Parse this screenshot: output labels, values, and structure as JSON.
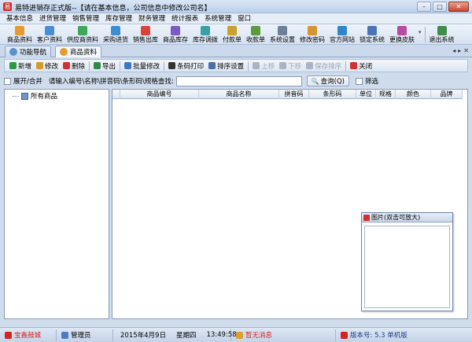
{
  "window": {
    "title": "易特进销存正式版--【请在基本信息，公司信息中修改公司名】",
    "min_label": "–",
    "max_label": "□",
    "close_label": "✕"
  },
  "menu": [
    "基本信息",
    "进货管理",
    "销售管理",
    "库存管理",
    "财务管理",
    "统计报表",
    "系统管理",
    "窗口"
  ],
  "toolbar": [
    {
      "label": "商品资料",
      "icon": "product-icon",
      "color": "#e79b2f"
    },
    {
      "label": "客户资料",
      "icon": "customer-icon",
      "color": "#4a8fd6"
    },
    {
      "label": "供应商资料",
      "icon": "supplier-icon",
      "color": "#3fa75a"
    },
    {
      "label": "采购进货",
      "icon": "purchase-icon",
      "color": "#3d8ed1"
    },
    {
      "label": "销售出库",
      "icon": "sales-icon",
      "color": "#d9433a"
    },
    {
      "label": "商品库存",
      "icon": "inventory-icon",
      "color": "#7a5bc4"
    },
    {
      "label": "库存调拨",
      "icon": "transfer-icon",
      "color": "#3aa0a8"
    },
    {
      "label": "付款单",
      "icon": "payment-icon",
      "color": "#c8a22a"
    },
    {
      "label": "收款单",
      "icon": "receipt-icon",
      "color": "#5a9c3b"
    },
    {
      "label": "系统设置",
      "icon": "settings-icon",
      "color": "#6f7f96"
    },
    {
      "label": "修改密码",
      "icon": "password-icon",
      "color": "#d6952e"
    },
    {
      "label": "官方网站",
      "icon": "website-icon",
      "color": "#2f86c9"
    },
    {
      "label": "锁定系统",
      "icon": "lock-icon",
      "color": "#4a74b8"
    },
    {
      "label": "更换皮肤",
      "icon": "skin-icon",
      "color": "#b84aa0"
    },
    {
      "label": "退出系统",
      "icon": "exit-icon",
      "color": "#3f8d4a"
    }
  ],
  "tabs": [
    {
      "label": "功能导航",
      "icon": "nav-icon",
      "color": "#5d8fd0"
    },
    {
      "label": "商品资料",
      "icon": "product-tab-icon",
      "color": "#e79b2f"
    }
  ],
  "tab_controls": [
    "◂",
    "▸",
    "✕"
  ],
  "actions": [
    {
      "label": "新增",
      "icon": "add-icon",
      "color": "#2d9a3f",
      "disabled": false
    },
    {
      "label": "修改",
      "icon": "edit-icon",
      "color": "#d69a2a",
      "disabled": false
    },
    {
      "label": "删除",
      "icon": "delete-icon",
      "color": "#d22f2f",
      "disabled": false
    },
    {
      "label": "导出",
      "icon": "export-icon",
      "color": "#2f8a45",
      "disabled": false
    },
    {
      "label": "批量修改",
      "icon": "batch-edit-icon",
      "color": "#3b78c4",
      "disabled": false
    },
    {
      "label": "条码打印",
      "icon": "barcode-print-icon",
      "color": "#333333",
      "disabled": false
    },
    {
      "label": "排序设置",
      "icon": "sort-settings-icon",
      "color": "#4b6fa8",
      "disabled": false
    },
    {
      "label": "上移",
      "icon": "move-up-icon",
      "color": "#a8b3c4",
      "disabled": true
    },
    {
      "label": "下移",
      "icon": "move-down-icon",
      "color": "#a8b3c4",
      "disabled": true
    },
    {
      "label": "保存排序",
      "icon": "save-sort-icon",
      "color": "#a8b3c4",
      "disabled": true
    },
    {
      "label": "关闭",
      "icon": "close-icon",
      "color": "#d22f2f",
      "disabled": false
    }
  ],
  "search": {
    "expand_label": "展开/合并",
    "prompt": "请输入编号\\名称\\拼音码\\条形码\\规格查找:",
    "value": "",
    "query_label": "查询(Q)",
    "filter_label": "筛选"
  },
  "tree": {
    "root_label": "所有商品"
  },
  "grid": {
    "columns": [
      {
        "label": "",
        "w": 10
      },
      {
        "label": "商品编号",
        "w": 100
      },
      {
        "label": "商品名称",
        "w": 102
      },
      {
        "label": "拼音码",
        "w": 38
      },
      {
        "label": "条形码",
        "w": 60
      },
      {
        "label": "单位",
        "w": 25
      },
      {
        "label": "规格",
        "w": 25
      },
      {
        "label": "颜色",
        "w": 45
      },
      {
        "label": "品牌",
        "w": 40
      }
    ]
  },
  "picture": {
    "title": "图片(双击可放大)"
  },
  "status": {
    "unit": "宝鑫鼓城",
    "user": "管理员",
    "date": "2015年4月9日",
    "weekday": "星期四",
    "time": "13:49:58",
    "message": "暂无消息",
    "version": "版本号: 5.3 单机版"
  }
}
